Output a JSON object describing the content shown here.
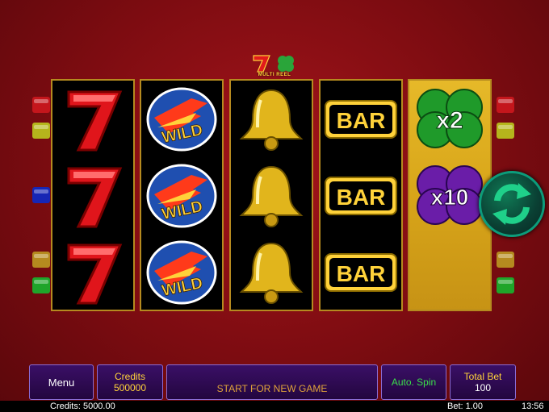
{
  "game": {
    "logo_text": "MULTI REEL",
    "multipliers": [
      "x2",
      "x10"
    ],
    "reels": [
      [
        "seven",
        "seven",
        "seven"
      ],
      [
        "wild",
        "wild",
        "wild"
      ],
      [
        "bell",
        "bell",
        "bell"
      ],
      [
        "bar",
        "bar",
        "bar"
      ],
      [
        "clover-x2",
        "clover-x10",
        "empty"
      ]
    ],
    "symbol_labels": {
      "wild": "WILD",
      "bar": "BAR"
    }
  },
  "controls": {
    "menu_label": "Menu",
    "credits_label": "Credits",
    "credits_value": "500000",
    "start_label": "START FOR NEW GAME",
    "auto_spin_label": "Auto. Spin",
    "total_bet_label": "Total Bet",
    "total_bet_value": "100"
  },
  "status_bar": {
    "credits": "Credits: 5000.00",
    "bet": "Bet: 1.00",
    "time": "13:56"
  },
  "colors": {
    "background": "#8a0f14",
    "reel_frame": "#b58a1f",
    "button_bg": "#2d0a52",
    "accent_yellow": "#ffd23a",
    "auto_spin_green": "#3adf4a",
    "spin_ring": "#0c9c7b"
  }
}
